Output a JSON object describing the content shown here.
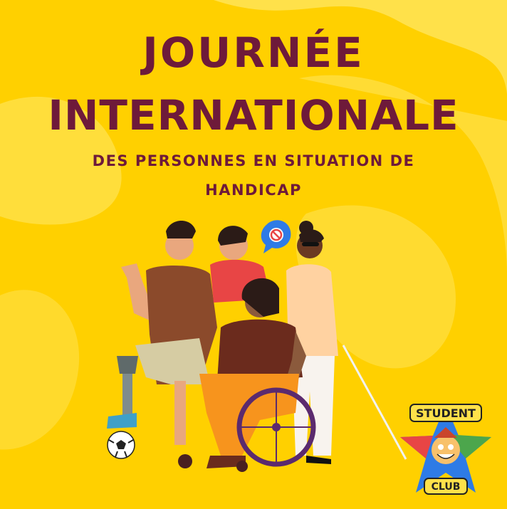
{
  "poster": {
    "title_line_1": "JOURNÉE",
    "title_line_2": "INTERNATIONALE",
    "subtitle_line_1": "DES PERSONNES EN SITUATION DE",
    "subtitle_line_2": "HANDICAP"
  },
  "logo": {
    "top_text": "STUDENT",
    "bottom_text": "CLUB"
  },
  "colors": {
    "background": "#FFD000",
    "background_blob": "#FFE14A",
    "title": "#6E1A3A",
    "accent_blue": "#2E7BE6"
  },
  "icons": [
    "soccer-ball-icon",
    "no-sign-speech-bubble-icon",
    "white-cane-icon",
    "wheelchair-icon",
    "prosthetic-leg-icon"
  ]
}
